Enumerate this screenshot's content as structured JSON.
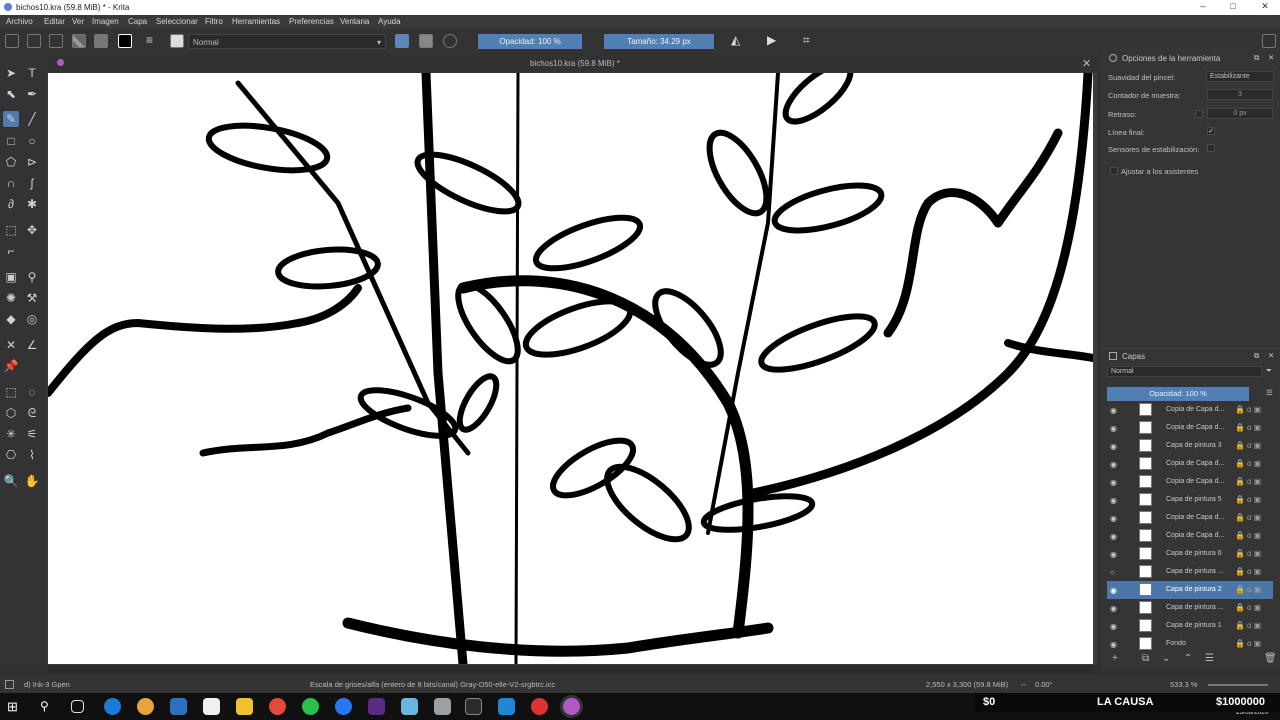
{
  "window": {
    "title": "bichos10.kra (59.8 MiB) * - Krita",
    "minimize": "–",
    "maximize": "□",
    "close": "✕"
  },
  "menu": [
    "Archivo",
    "Editar",
    "Ver",
    "Imagen",
    "Capa",
    "Seleccionar",
    "Filtro",
    "Herramientas",
    "Preferencias",
    "Ventana",
    "Ayuda"
  ],
  "toolbar": {
    "blend_mode": "Normal",
    "opacity": "Opacidad: 100 %",
    "size": "Tamaño: 34.29 px"
  },
  "document": {
    "tab_title": "bichos10.kra (59.8 MiB) *",
    "close": "✕"
  },
  "tool_options": {
    "title": "Opciones de la herramienta",
    "smoothing_label": "Suavidad del pincel:",
    "smoothing_value": "Estabilizante",
    "sample_label": "Contador de muestra:",
    "sample_value": "3",
    "delay_label": "Retraso:",
    "delay_value": "0 px",
    "finish_label": "Línea final:",
    "finish_check": "✓",
    "sensors_label": "Sensores de estabilización:",
    "assistants_label": "Ajustar a los asistentes"
  },
  "layers": {
    "title": "Capas",
    "blend_mode": "Normal",
    "opacity": "Opacidad: 100 %",
    "items": [
      {
        "name": "Copia de Capa d...",
        "visible": true,
        "selected": false
      },
      {
        "name": "Copia de Capa d...",
        "visible": true,
        "selected": false
      },
      {
        "name": "Capa de pintura 3",
        "visible": true,
        "selected": false
      },
      {
        "name": "Copia de Capa d...",
        "visible": true,
        "selected": false
      },
      {
        "name": "Copia de Capa d...",
        "visible": true,
        "selected": false
      },
      {
        "name": "Capa de pintura 5",
        "visible": true,
        "selected": false
      },
      {
        "name": "Copia de Capa d...",
        "visible": true,
        "selected": false
      },
      {
        "name": "Copia de Capa d...",
        "visible": true,
        "selected": false
      },
      {
        "name": "Capa de pintura 6",
        "visible": true,
        "selected": false
      },
      {
        "name": "Capa de pintura ...",
        "visible": false,
        "selected": false
      },
      {
        "name": "Capa de pintura 2",
        "visible": true,
        "selected": true
      },
      {
        "name": "Capa de pintura ...",
        "visible": true,
        "selected": false
      },
      {
        "name": "Capa de pintura 1",
        "visible": true,
        "selected": false
      },
      {
        "name": "Fondo",
        "visible": true,
        "selected": false
      }
    ]
  },
  "status": {
    "brush": "d) Ink-3 Gpen",
    "color_space": "Escala de grises/alfa (entero de 8 bits/canal)  Gray-D50-elle-V2-srgbtrc.icc",
    "dims": "2,550 x 3,300 (59.8 MiB)",
    "rotation": "0.00°",
    "zoom": "533.3 %"
  },
  "taskbar": {
    "date": "23/08/2020"
  },
  "overlay": {
    "left": "$0",
    "center": "LA CAUSA",
    "right": "$1000000"
  }
}
